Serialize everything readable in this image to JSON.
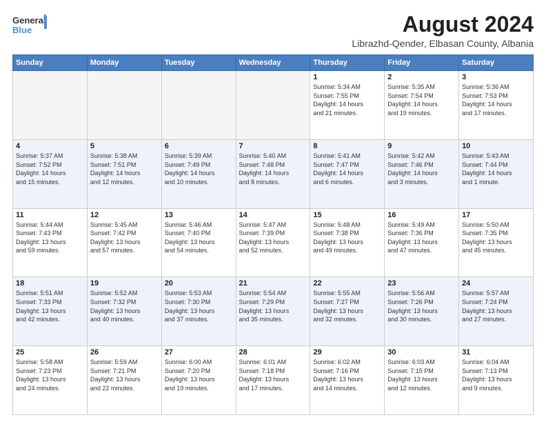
{
  "logo": {
    "line1": "General",
    "line2": "Blue"
  },
  "title": "August 2024",
  "subtitle": "Librazhd-Qender, Elbasan County, Albania",
  "weekdays": [
    "Sunday",
    "Monday",
    "Tuesday",
    "Wednesday",
    "Thursday",
    "Friday",
    "Saturday"
  ],
  "weeks": [
    [
      {
        "day": "",
        "info": ""
      },
      {
        "day": "",
        "info": ""
      },
      {
        "day": "",
        "info": ""
      },
      {
        "day": "",
        "info": ""
      },
      {
        "day": "1",
        "info": "Sunrise: 5:34 AM\nSunset: 7:55 PM\nDaylight: 14 hours\nand 21 minutes."
      },
      {
        "day": "2",
        "info": "Sunrise: 5:35 AM\nSunset: 7:54 PM\nDaylight: 14 hours\nand 19 minutes."
      },
      {
        "day": "3",
        "info": "Sunrise: 5:36 AM\nSunset: 7:53 PM\nDaylight: 14 hours\nand 17 minutes."
      }
    ],
    [
      {
        "day": "4",
        "info": "Sunrise: 5:37 AM\nSunset: 7:52 PM\nDaylight: 14 hours\nand 15 minutes."
      },
      {
        "day": "5",
        "info": "Sunrise: 5:38 AM\nSunset: 7:51 PM\nDaylight: 14 hours\nand 12 minutes."
      },
      {
        "day": "6",
        "info": "Sunrise: 5:39 AM\nSunset: 7:49 PM\nDaylight: 14 hours\nand 10 minutes."
      },
      {
        "day": "7",
        "info": "Sunrise: 5:40 AM\nSunset: 7:48 PM\nDaylight: 14 hours\nand 8 minutes."
      },
      {
        "day": "8",
        "info": "Sunrise: 5:41 AM\nSunset: 7:47 PM\nDaylight: 14 hours\nand 6 minutes."
      },
      {
        "day": "9",
        "info": "Sunrise: 5:42 AM\nSunset: 7:46 PM\nDaylight: 14 hours\nand 3 minutes."
      },
      {
        "day": "10",
        "info": "Sunrise: 5:43 AM\nSunset: 7:44 PM\nDaylight: 14 hours\nand 1 minute."
      }
    ],
    [
      {
        "day": "11",
        "info": "Sunrise: 5:44 AM\nSunset: 7:43 PM\nDaylight: 13 hours\nand 59 minutes."
      },
      {
        "day": "12",
        "info": "Sunrise: 5:45 AM\nSunset: 7:42 PM\nDaylight: 13 hours\nand 57 minutes."
      },
      {
        "day": "13",
        "info": "Sunrise: 5:46 AM\nSunset: 7:40 PM\nDaylight: 13 hours\nand 54 minutes."
      },
      {
        "day": "14",
        "info": "Sunrise: 5:47 AM\nSunset: 7:39 PM\nDaylight: 13 hours\nand 52 minutes."
      },
      {
        "day": "15",
        "info": "Sunrise: 5:48 AM\nSunset: 7:38 PM\nDaylight: 13 hours\nand 49 minutes."
      },
      {
        "day": "16",
        "info": "Sunrise: 5:49 AM\nSunset: 7:36 PM\nDaylight: 13 hours\nand 47 minutes."
      },
      {
        "day": "17",
        "info": "Sunrise: 5:50 AM\nSunset: 7:35 PM\nDaylight: 13 hours\nand 45 minutes."
      }
    ],
    [
      {
        "day": "18",
        "info": "Sunrise: 5:51 AM\nSunset: 7:33 PM\nDaylight: 13 hours\nand 42 minutes."
      },
      {
        "day": "19",
        "info": "Sunrise: 5:52 AM\nSunset: 7:32 PM\nDaylight: 13 hours\nand 40 minutes."
      },
      {
        "day": "20",
        "info": "Sunrise: 5:53 AM\nSunset: 7:30 PM\nDaylight: 13 hours\nand 37 minutes."
      },
      {
        "day": "21",
        "info": "Sunrise: 5:54 AM\nSunset: 7:29 PM\nDaylight: 13 hours\nand 35 minutes."
      },
      {
        "day": "22",
        "info": "Sunrise: 5:55 AM\nSunset: 7:27 PM\nDaylight: 13 hours\nand 32 minutes."
      },
      {
        "day": "23",
        "info": "Sunrise: 5:56 AM\nSunset: 7:26 PM\nDaylight: 13 hours\nand 30 minutes."
      },
      {
        "day": "24",
        "info": "Sunrise: 5:57 AM\nSunset: 7:24 PM\nDaylight: 13 hours\nand 27 minutes."
      }
    ],
    [
      {
        "day": "25",
        "info": "Sunrise: 5:58 AM\nSunset: 7:23 PM\nDaylight: 13 hours\nand 24 minutes."
      },
      {
        "day": "26",
        "info": "Sunrise: 5:59 AM\nSunset: 7:21 PM\nDaylight: 13 hours\nand 22 minutes."
      },
      {
        "day": "27",
        "info": "Sunrise: 6:00 AM\nSunset: 7:20 PM\nDaylight: 13 hours\nand 19 minutes."
      },
      {
        "day": "28",
        "info": "Sunrise: 6:01 AM\nSunset: 7:18 PM\nDaylight: 13 hours\nand 17 minutes."
      },
      {
        "day": "29",
        "info": "Sunrise: 6:02 AM\nSunset: 7:16 PM\nDaylight: 13 hours\nand 14 minutes."
      },
      {
        "day": "30",
        "info": "Sunrise: 6:03 AM\nSunset: 7:15 PM\nDaylight: 13 hours\nand 12 minutes."
      },
      {
        "day": "31",
        "info": "Sunrise: 6:04 AM\nSunset: 7:13 PM\nDaylight: 13 hours\nand 9 minutes."
      }
    ]
  ]
}
